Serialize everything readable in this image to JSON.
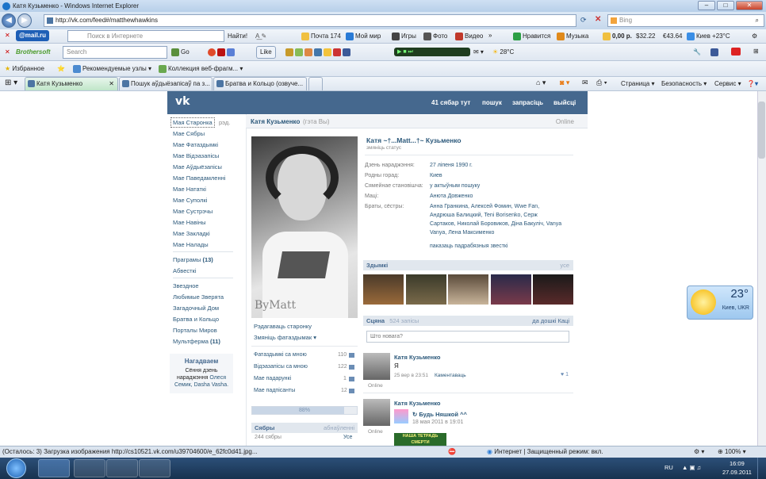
{
  "window": {
    "title": "Катя Кузьменко - Windows Internet Explorer",
    "min": "–",
    "max": "□",
    "close": "✕"
  },
  "addressbar": {
    "url": "http://vk.com/feed#/matthewhawkins",
    "search_placeholder": "Bing"
  },
  "mailru_bar": {
    "logo": "@mail.ru",
    "search_placeholder": "Поиск в Интернете",
    "find": "Найти!",
    "mail": "Почта 174",
    "myworld": "Мой мир",
    "games": "Игры",
    "photo": "Фото",
    "video": "Видео",
    "like": "Нравится",
    "music": "Музыка",
    "rub": "0,00 р.",
    "usd": "$32.22",
    "eur": "€43.64",
    "weather": "Киев +23°С"
  },
  "brothersoft_bar": {
    "logo": "Brothersoft",
    "search_placeholder": "Search",
    "go": "Go",
    "like": "Like",
    "temp": "28°C"
  },
  "favorites_bar": {
    "favorites": "Избранное",
    "recommended": "Рекомендуемые узлы",
    "gallery": "Коллекция веб-фрагм..."
  },
  "tabs": [
    {
      "label": "Катя Кузьменко",
      "active": true
    },
    {
      "label": "Пошук аўдыёзапісаў па з..."
    },
    {
      "label": "Братва и Кольцо (озвуче..."
    }
  ],
  "commandbar": {
    "page": "Страница",
    "safety": "Безопасность",
    "service": "Сервис"
  },
  "vk": {
    "logo": "vk",
    "nav": [
      "41 сябар тут",
      "пошук",
      "запрасіць",
      "выйсці"
    ],
    "left_menu": {
      "my_page": "Мая Старонка",
      "edit": "рэд.",
      "items": [
        "Мае Сябры",
        "Мае Фатаздымкі",
        "Мае Відэазапісы",
        "Мае Аўдыёзапісы",
        "Мае Паведамленні",
        "Мае Нататкі",
        "Мае Суполкі",
        "Мае Сустрэчы",
        "Мае Навіны",
        "Мае Закладкі",
        "Мае Налады"
      ],
      "apps_label": "Праграмы",
      "apps_count": "(13)",
      "ads": "Абвесткі",
      "apps": [
        "Звездное",
        "Любимые Зверята",
        "Загадочный Дом",
        "Братва и Кольцо",
        "Порталы Миров"
      ],
      "multferma": "Мультферма",
      "multferma_count": "(11)"
    },
    "remind": {
      "title": "Нагадваем",
      "text1": "Сёння дзень нараджэння",
      "text2": "Олеся Семик, Dasha Vasha."
    },
    "profile": {
      "header_name": "Катя Кузьменко",
      "header_you": "(гэта Вы)",
      "header_online": "Online",
      "full_name": "Катя ~†...Matt...†~ Кузьменко",
      "change_status": "змяніць статус",
      "fields": [
        {
          "label": "Дзень нараджэння:",
          "value": "27 ліпеня 1990 г."
        },
        {
          "label": "Родны горад:",
          "value": "Киев"
        },
        {
          "label": "Сямейнае становішча:",
          "value": "у актыўным пошуку"
        },
        {
          "label": "Маці:",
          "value": "Анюта Довженко"
        }
      ],
      "siblings_label": "Браты, сёстры:",
      "siblings_lines": [
        "Анна Гранкина, Алексей Фомин, Wwe Fan,",
        "Андрюша Балицкий, Teni Borisenko, Серж",
        "Сартаков, Николай Боровиков, Дiна Бакуліч, Vanya",
        "Vanya, Лена Максименко"
      ],
      "more_info": "паказаць падрабязныя звесткі",
      "photo_sign": "ByMatt"
    },
    "actions": {
      "edit": "Рэдагаваць старонку",
      "change_photo": "Змяніць фатаздымак"
    },
    "counters": [
      {
        "label": "Фатаздымкі са мною",
        "count": "110"
      },
      {
        "label": "Відэазапісы са мною",
        "count": "122"
      },
      {
        "label": "Мае падарункі",
        "count": "1"
      },
      {
        "label": "Мае падпісанты",
        "count": "12"
      }
    ],
    "progress": {
      "label": "88%",
      "value": 88
    },
    "friends": {
      "title": "Сябры",
      "change": "абнаўленні",
      "count": "244 сябры",
      "all": "Усе"
    },
    "photos": {
      "title": "Здымкі",
      "all": "усе"
    },
    "wall": {
      "title": "Сцяна",
      "count": "524 запісы",
      "add": "да дошкі Каці",
      "placeholder": "Што новага?",
      "posts": [
        {
          "author": "Катя Кузьменко",
          "text": "Я",
          "date": "25 вер в 23:51",
          "comment": "Каментаваць",
          "likes": "1",
          "online": "Online"
        },
        {
          "author": "Катя Кузьменко",
          "group": "Будь Няшкой ^^",
          "date": "18 мая 2011 в 19:01",
          "online": "Online",
          "banner": "НАША ТЕТРАДЬ СМЕРТИ"
        }
      ]
    }
  },
  "gadget": {
    "temp": "23°",
    "city": "Киев, UKR"
  },
  "statusbar": {
    "text": "(Осталось: 3) Загрузка изображения http://cs10521.vk.com/u39704600/e_62fc0d41.jpg...",
    "zone": "Интернет | Защищенный режим: вкл.",
    "zoom": "100%"
  },
  "taskbar": {
    "lang": "RU",
    "time": "16:09",
    "date": "27.09.2011"
  },
  "colors": {
    "vk_blue": "#45688e",
    "link": "#2b587a",
    "ie_frame": "#c6d8ec"
  }
}
